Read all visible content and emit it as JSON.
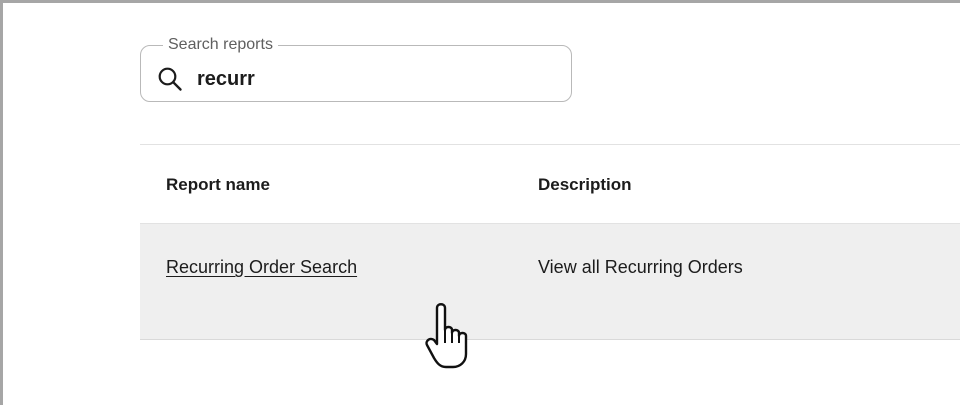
{
  "search": {
    "legend": "Search reports",
    "value": "recurr"
  },
  "table": {
    "columns": [
      "Report name",
      "Description"
    ],
    "rows": [
      {
        "report_name": "Recurring Order Search",
        "description": "View all Recurring Orders"
      }
    ]
  },
  "icons": {
    "search": "search-icon",
    "cursor": "hand-pointer-cursor-icon"
  }
}
